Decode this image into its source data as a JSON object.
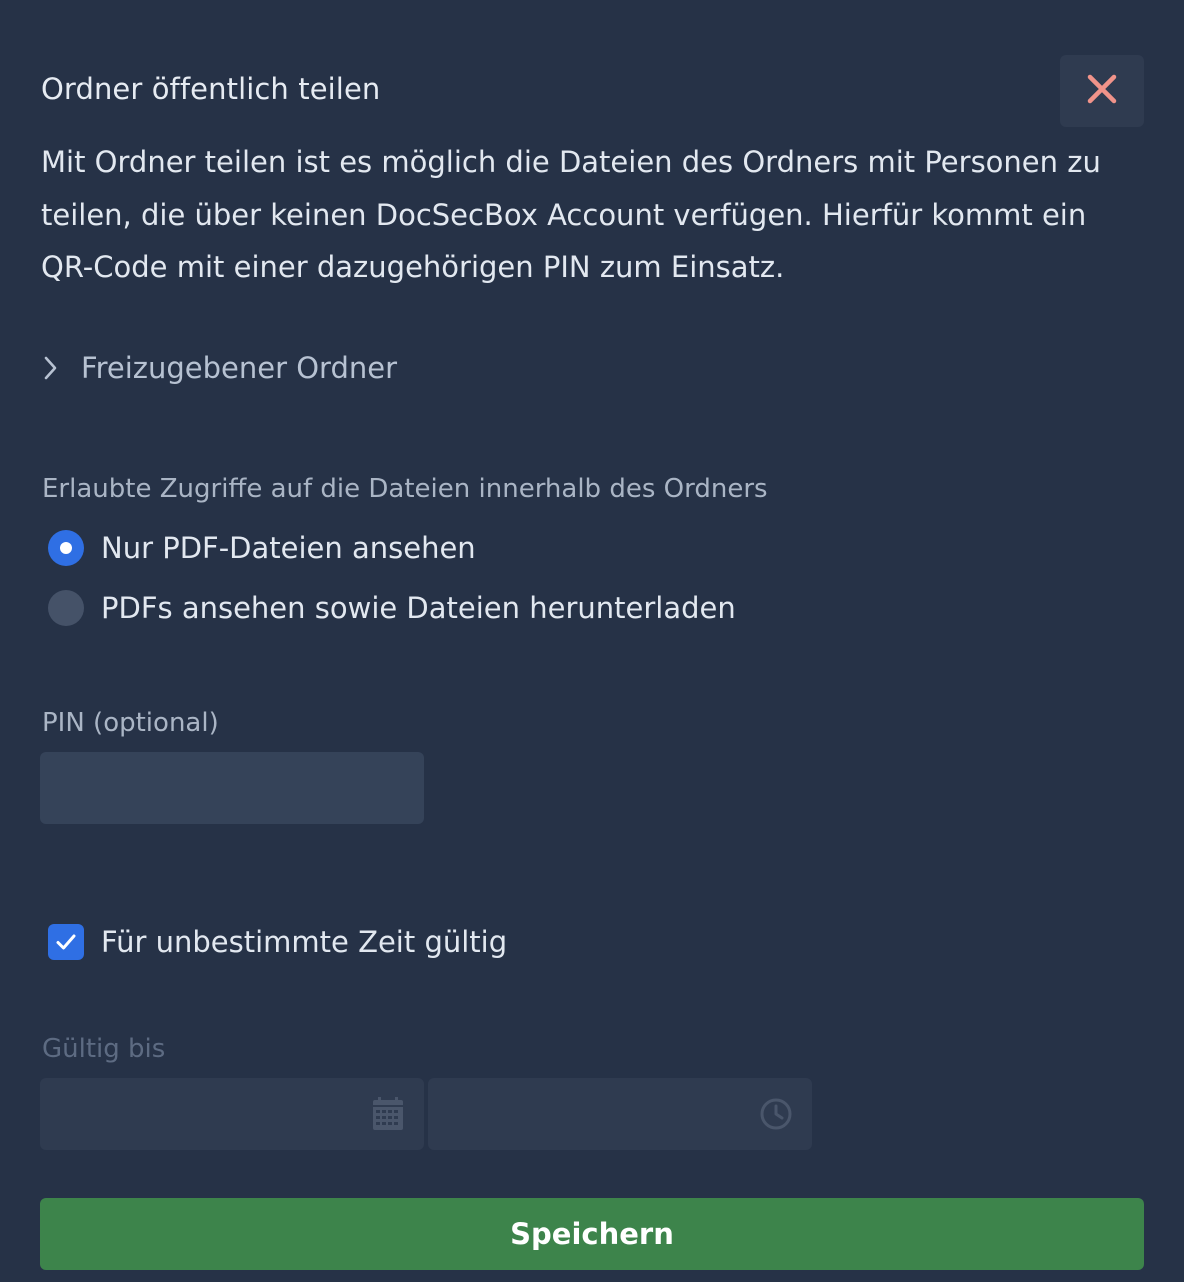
{
  "dialog": {
    "title": "Ordner öffentlich teilen",
    "close_icon": "close-icon",
    "intro_text": "Mit Ordner teilen ist es möglich die Dateien des Ordners mit Personen zu teilen, die über keinen DocSecBox Account verfügen. Hierfür kommt ein QR-Code mit einer dazugehörigen PIN zum Einsatz."
  },
  "folder_section": {
    "label": "Freizugebener Ordner",
    "icon": "chevron-right-icon",
    "expanded": false
  },
  "access": {
    "label": "Erlaubte Zugriffe auf die Dateien innerhalb des Ordners",
    "options": [
      {
        "label": "Nur PDF-Dateien ansehen",
        "checked": true
      },
      {
        "label": "PDFs ansehen sowie Dateien herunterladen",
        "checked": false
      }
    ]
  },
  "pin": {
    "label": "PIN (optional)",
    "value": ""
  },
  "unlimited": {
    "label": "Für unbestimmte Zeit gültig",
    "checked": true
  },
  "valid_until": {
    "label": "Gültig bis",
    "date_value": "",
    "time_value": "",
    "date_icon": "calendar-icon",
    "time_icon": "clock-icon",
    "disabled": true
  },
  "actions": {
    "save_label": "Speichern"
  },
  "colors": {
    "background": "#263247",
    "accent": "#2f6fe4",
    "close": "#f0938a",
    "save": "#3d844b"
  }
}
